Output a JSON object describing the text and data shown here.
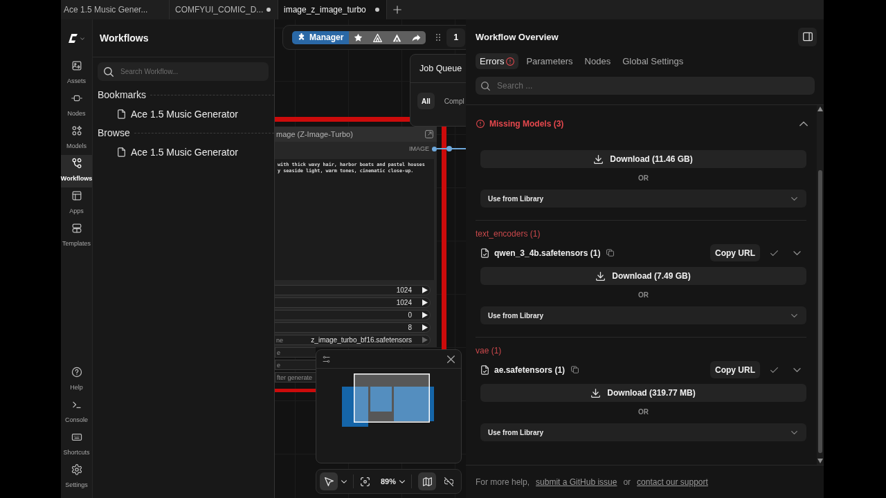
{
  "tabs": [
    {
      "label": "Ace 1.5 Music Gener...",
      "selected": false,
      "unsaved": false
    },
    {
      "label": "COMFYUI_COMIC_D...",
      "selected": false,
      "unsaved": true
    },
    {
      "label": "image_z_image_turbo",
      "selected": true,
      "unsaved": true
    }
  ],
  "rail": {
    "top": [
      {
        "kind": "assets",
        "label": "Assets",
        "selected": false
      },
      {
        "kind": "nodes",
        "label": "Nodes",
        "selected": false
      },
      {
        "kind": "models",
        "label": "Models",
        "selected": false
      },
      {
        "kind": "workflows",
        "label": "Workflows",
        "selected": true
      },
      {
        "kind": "apps",
        "label": "Apps",
        "selected": false
      },
      {
        "kind": "templates",
        "label": "Templates",
        "selected": false
      }
    ],
    "bottom": [
      {
        "kind": "help",
        "label": "Help",
        "selected": false
      },
      {
        "kind": "console",
        "label": "Console",
        "selected": false
      },
      {
        "kind": "shortcuts",
        "label": "Shortcuts",
        "selected": false
      },
      {
        "kind": "settings",
        "label": "Settings",
        "selected": false
      }
    ]
  },
  "sidebar": {
    "title": "Workflows",
    "search": {
      "placeholder": "Search Workflow..."
    },
    "sections": [
      {
        "title": "Bookmarks",
        "items": [
          {
            "label": "Ace 1.5 Music Generator"
          }
        ]
      },
      {
        "title": "Browse",
        "items": [
          {
            "label": "Ace 1.5 Music Generator"
          }
        ]
      }
    ]
  },
  "canvas": {
    "toolbar": {
      "manager": "Manager",
      "queue_count": "1"
    },
    "job_queue": {
      "title": "Job Queue",
      "filters": [
        {
          "label": "All",
          "selected": true
        },
        {
          "label": "Compl",
          "selected": false
        }
      ]
    },
    "node": {
      "title": "mage (Z-Image-Turbo)",
      "output": "IMAGE",
      "prompt_lines": [
        "with thick wavy hair, harbor boats and pastel houses",
        "y seaside light, warm tones, cinematic close-up."
      ],
      "widgets": [
        {
          "kind": "number",
          "value": "1024"
        },
        {
          "kind": "number",
          "value": "1024"
        },
        {
          "kind": "number",
          "value": "0"
        },
        {
          "kind": "number",
          "value": "8"
        },
        {
          "kind": "combo",
          "label": "ne",
          "value": "z_image_turbo_bf16.safetensors"
        },
        {
          "kind": "cut",
          "label": "e"
        },
        {
          "kind": "cut",
          "label": "e"
        },
        {
          "kind": "cut",
          "label": "fter generate"
        }
      ]
    },
    "view_controls": {
      "pointer": {
        "selected": true
      },
      "zoom": "89%",
      "minimap": {
        "selected": true
      }
    }
  },
  "overview": {
    "title": "Workflow Overview",
    "tabs": [
      {
        "label": "Errors",
        "selected": true,
        "alert": true
      },
      {
        "label": "Parameters",
        "selected": false,
        "alert": false
      },
      {
        "label": "Nodes",
        "selected": false,
        "alert": false
      },
      {
        "label": "Global Settings",
        "selected": false,
        "alert": false
      }
    ],
    "search": {
      "placeholder": "Search ..."
    },
    "group": {
      "title": "Missing Models (3)",
      "expanded": true,
      "categories": [
        {
          "models": [
            {
              "download": "Download (11.46 GB)",
              "or": "OR",
              "library": "Use from Library"
            }
          ]
        },
        {
          "name": "text_encoders (1)",
          "models": [
            {
              "file": "qwen_3_4b.safetensors (1)",
              "copy_url": "Copy URL",
              "download": "Download (7.49 GB)",
              "or": "OR",
              "library": "Use from Library"
            }
          ]
        },
        {
          "name": "vae (1)",
          "models": [
            {
              "file": "ae.safetensors (1)",
              "copy_url": "Copy URL",
              "download": "Download (319.77 MB)",
              "or": "OR",
              "library": "Use from Library"
            }
          ]
        }
      ]
    },
    "help": [
      {
        "kind": "text",
        "text": "For more help,"
      },
      {
        "kind": "link",
        "text": "submit a GitHub issue"
      },
      {
        "kind": "text",
        "text": "or"
      },
      {
        "kind": "link",
        "text": "contact our support"
      }
    ]
  }
}
